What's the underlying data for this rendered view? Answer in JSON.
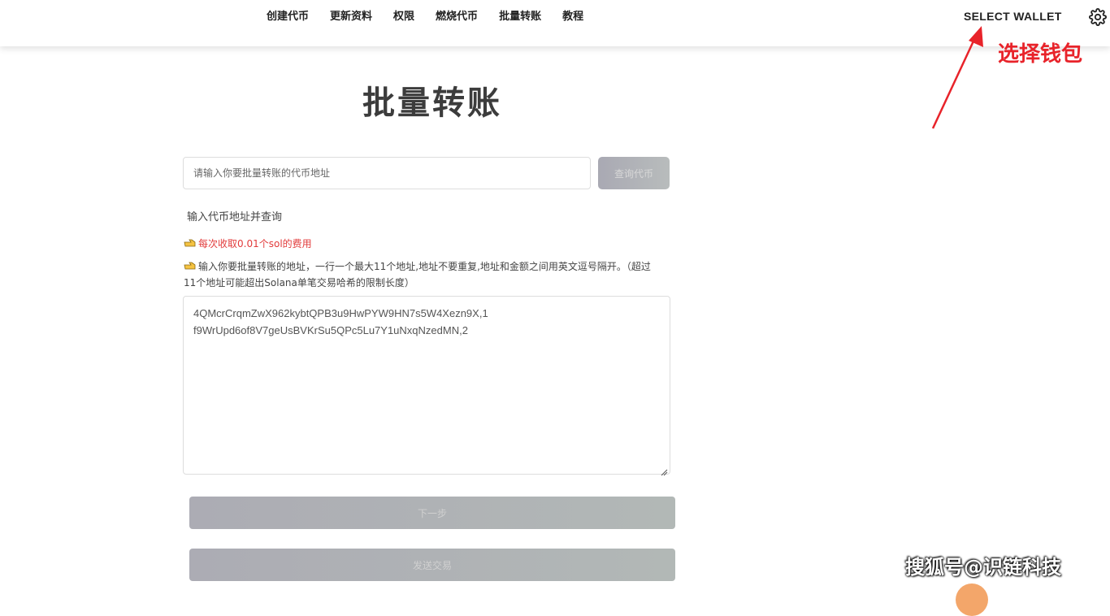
{
  "nav": {
    "items": [
      {
        "label": "创建代币"
      },
      {
        "label": "更新资料"
      },
      {
        "label": "权限"
      },
      {
        "label": "燃烧代币"
      },
      {
        "label": "批量转账"
      },
      {
        "label": "教程"
      }
    ]
  },
  "header": {
    "wallet_label": "SELECT WALLET",
    "settings_icon": "gear-icon"
  },
  "annotation": {
    "text": "选择钱包",
    "color": "#e8232a"
  },
  "main": {
    "title": "批量转账",
    "token_input": {
      "placeholder": "请输入你要批量转账的代币地址",
      "value": ""
    },
    "query_label": "查询代币",
    "hint": "输入代币地址并查询",
    "fee_note": "每次收取0.01个sol的费用",
    "instructions": "输入你要批量转账的地址，一行一个最大11个地址,地址不要重复,地址和金额之间用英文逗号隔开。（超过11个地址可能超出Solana单笔交易哈希的限制长度）",
    "addresses": "4QMcrCrqmZwX962kybtQPB3u9HwPYW9HN7s5W4Xezn9X,1\nf9WrUpd6of8V7geUsBVKrSu5QPc5Lu7Y1uNxqNzedMN,2",
    "next_label": "下一步",
    "send_label": "发送交易"
  },
  "watermark": "搜狐号@识链科技"
}
